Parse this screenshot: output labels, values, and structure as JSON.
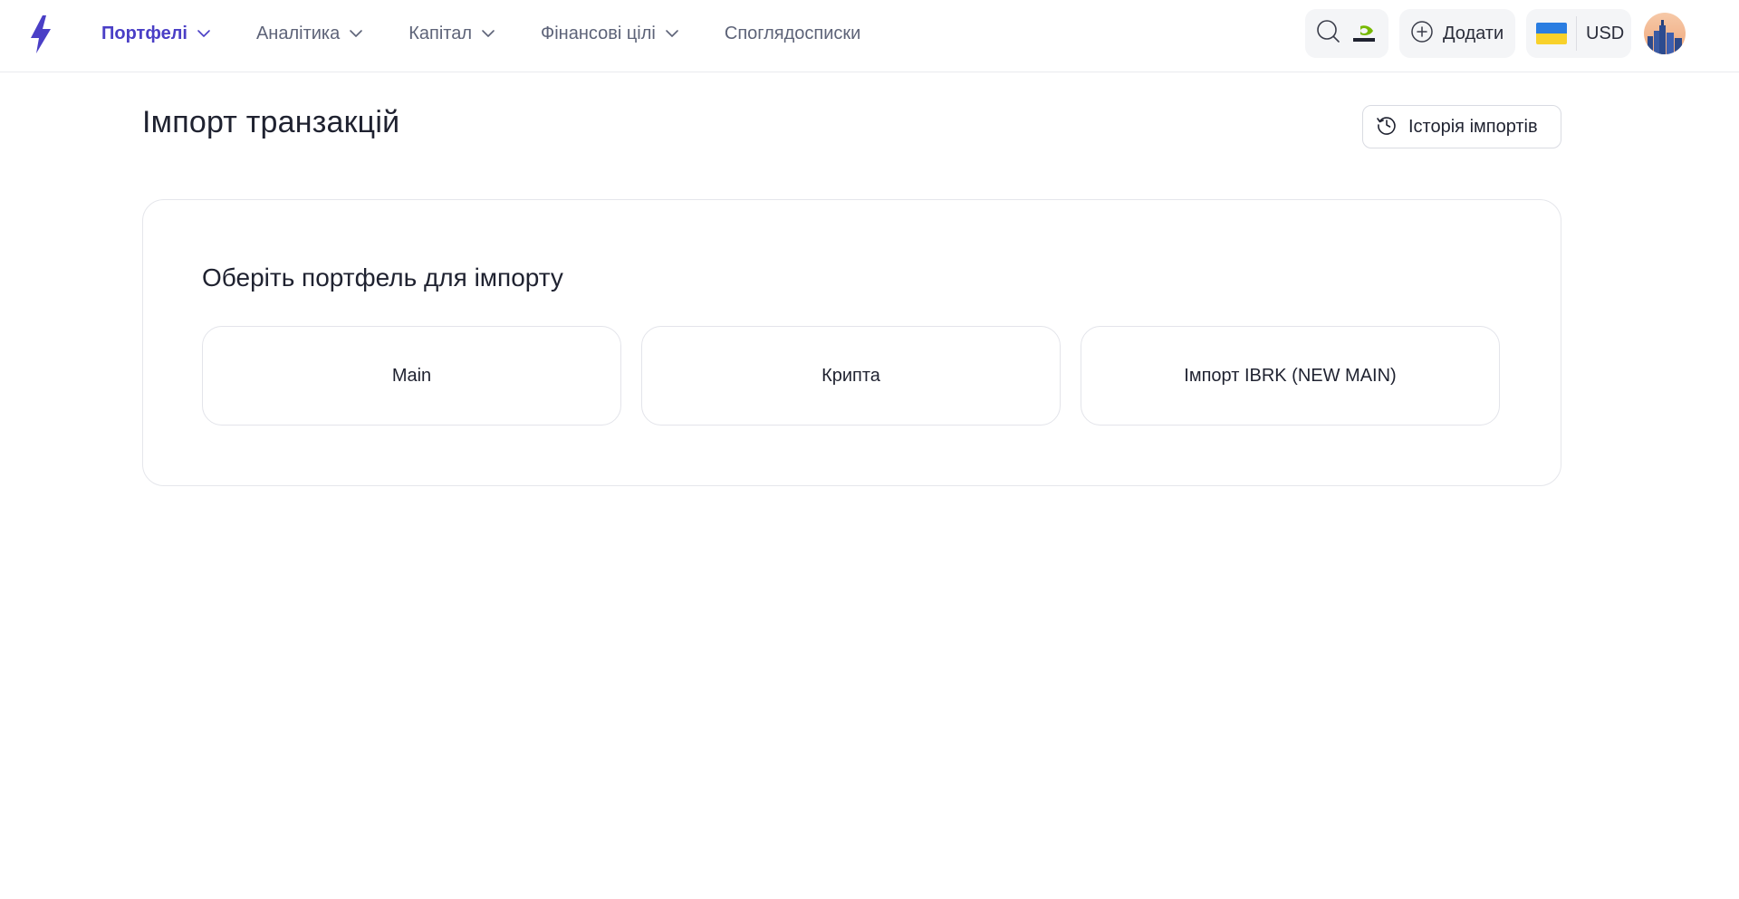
{
  "nav": {
    "items": [
      {
        "label": "Портфелі",
        "active": true,
        "dropdown": true
      },
      {
        "label": "Аналітика",
        "active": false,
        "dropdown": true
      },
      {
        "label": "Капітал",
        "active": false,
        "dropdown": true
      },
      {
        "label": "Фінансові цілі",
        "active": false,
        "dropdown": true
      },
      {
        "label": "Споглядосписки",
        "active": false,
        "dropdown": false
      }
    ]
  },
  "toolbar": {
    "search_icon": "search-icon",
    "ticker_logo": "nvidia-logo",
    "add_label": "Додати",
    "currency_label": "USD",
    "flag": "ukraine-flag"
  },
  "page": {
    "title": "Імпорт транзакцій",
    "history_button_label": "Історія імпортів"
  },
  "import_card": {
    "title": "Оберіть портфель для імпорту",
    "portfolios": [
      "Main",
      "Крипта",
      "Імпорт IBRK (NEW MAIN)"
    ]
  },
  "colors": {
    "accent": "#4a3fc6",
    "nav_text": "#5d6378",
    "pill_bg": "#f4f5f7",
    "border": "#e3e4ea"
  }
}
